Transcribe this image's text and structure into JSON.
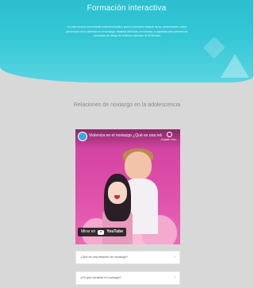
{
  "hero": {
    "title": "Formación interactiva",
    "description": "En esta sección encontrarás material didáctico para la formación integral de los adolescentes, sobre prevención de la violencia en el noviazgo. Material diseñado, en esencia, a capacitar para prevenir las conductas de riesgo de violencia, ejercicio de la libertad."
  },
  "section": {
    "title": "Relaciones de noviazgo en la adolescencia"
  },
  "video": {
    "title": "Violencia en el noviazgo ¿Qué es una relaci...",
    "copy_link_label": "Copiar vínc...",
    "watch_on_label": "Mirar en",
    "youtube_brand": "YouTube"
  },
  "accordion": {
    "items": [
      {
        "label": "¿Qué es una relación de noviazgo?"
      },
      {
        "label": "¿En qué consiste el noviazgo?"
      }
    ]
  },
  "colors": {
    "hero": "#34c7d6",
    "video_bg": "#e24fa8",
    "page_bg": "#d8d8d8"
  }
}
